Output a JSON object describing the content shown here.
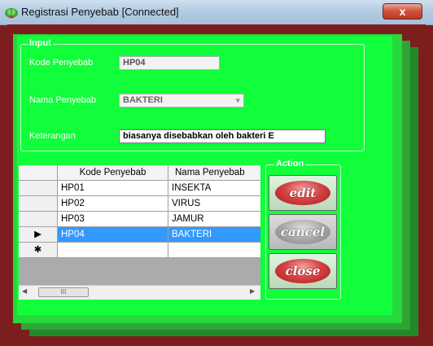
{
  "window": {
    "title": "Registrasi Penyebab [Connected]",
    "close_label": "x",
    "app_icon": "lettuce-icon"
  },
  "input_group": {
    "legend": "Input",
    "kode_label": "Kode Penyebab",
    "kode_value": "HP04",
    "nama_label": "Nama Penyebab",
    "nama_value": "BAKTERI",
    "keterangan_label": "Keterangan",
    "keterangan_value": "biasanya disebabkan oleh bakteri E"
  },
  "grid": {
    "columns": [
      "Kode Penyebab",
      "Nama Penyebab"
    ],
    "rows": [
      {
        "kode": "HP01",
        "nama": "INSEKTA"
      },
      {
        "kode": "HP02",
        "nama": "VIRUS"
      },
      {
        "kode": "HP03",
        "nama": "JAMUR"
      },
      {
        "kode": "HP04",
        "nama": "BAKTERI",
        "selected": true
      }
    ],
    "current_row_marker": "▶",
    "new_row_marker": "✱",
    "scroll_left": "◀",
    "scroll_right": "▶",
    "scroll_grip": "III"
  },
  "action_group": {
    "legend": "Action",
    "edit_label": "edit",
    "cancel_label": "cancel",
    "close_label": "close"
  },
  "colors": {
    "form_green": "#10ff3a",
    "selection_blue": "#3399ff",
    "button_red": "#d64545"
  }
}
